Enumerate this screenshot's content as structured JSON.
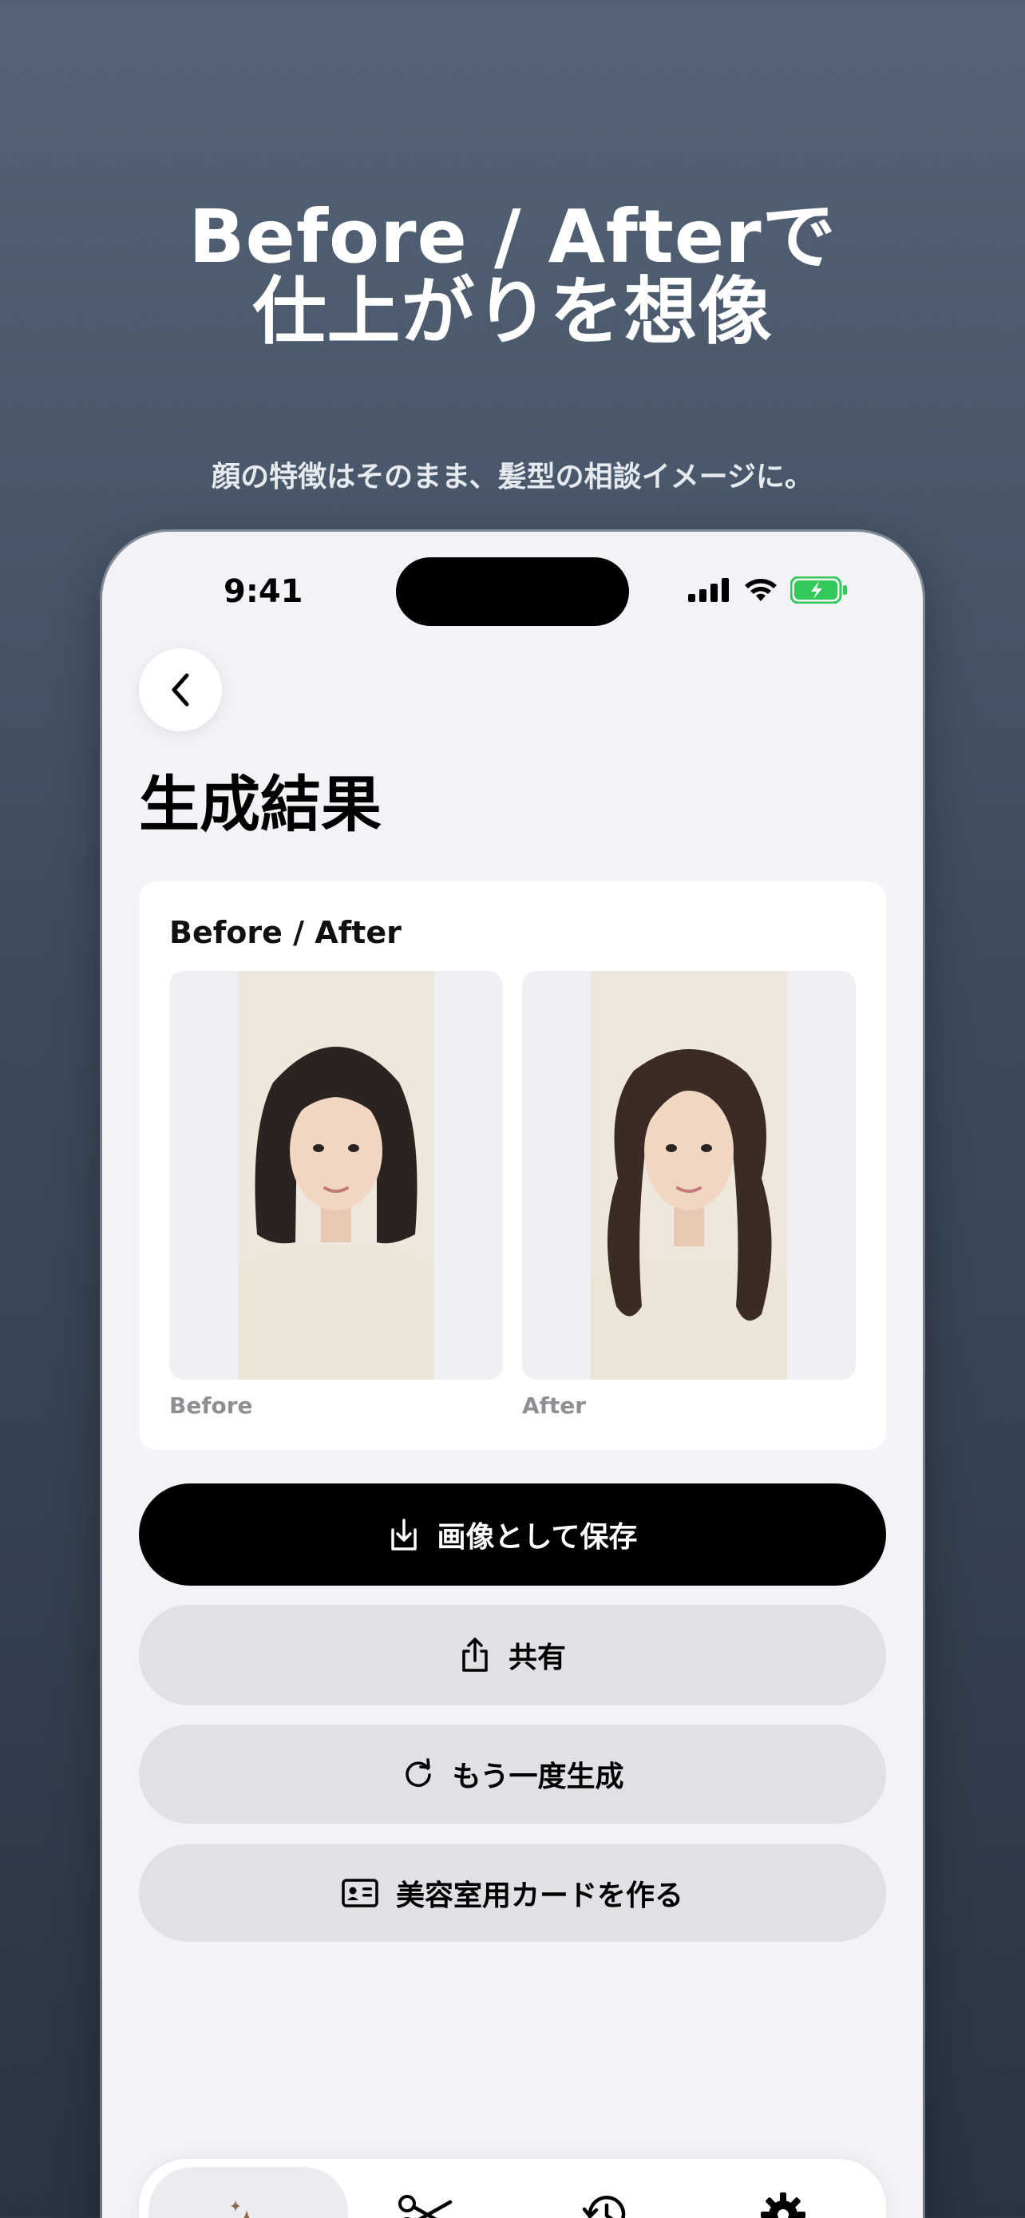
{
  "promo": {
    "headline_line1": "Before / Afterで",
    "headline_line2": "仕上がりを想像",
    "subheadline": "顔の特徴はそのまま、髪型の相談イメージに。"
  },
  "status_bar": {
    "time": "9:41"
  },
  "screen": {
    "title": "生成結果",
    "card": {
      "title": "Before / After",
      "before_caption": "Before",
      "after_caption": "After"
    },
    "actions": {
      "save_label": "画像として保存",
      "share_label": "共有",
      "regenerate_label": "もう一度生成",
      "salon_card_label": "美容室用カードを作る"
    }
  },
  "tabbar": {
    "items": [
      {
        "icon": "sparkles-icon",
        "active": true
      },
      {
        "icon": "scissors-icon",
        "active": false
      },
      {
        "icon": "history-icon",
        "active": false
      },
      {
        "icon": "gear-icon",
        "active": false
      }
    ]
  },
  "colors": {
    "primary_button": "#000000",
    "secondary_button": "#e0e0e5",
    "active_tab_icon": "#8b6a4f",
    "battery": "#34c759"
  }
}
